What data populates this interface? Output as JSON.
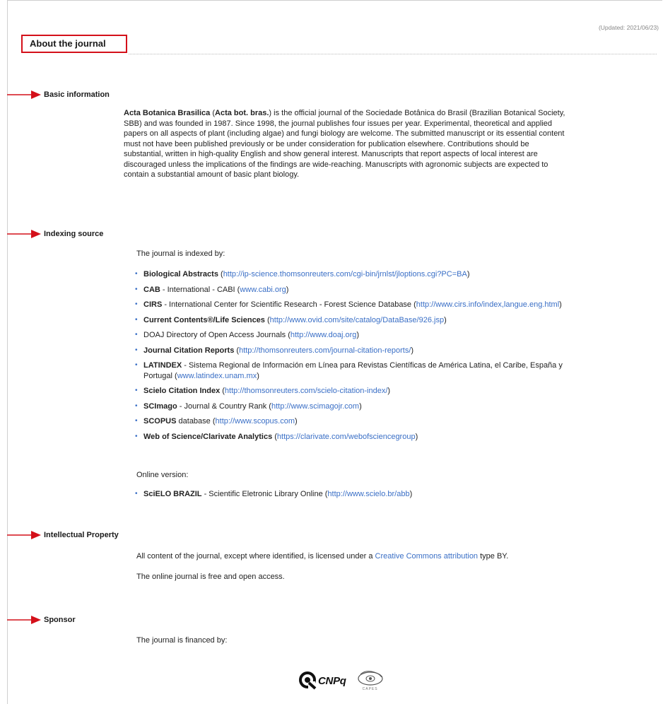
{
  "updated": "(Updated: 2021/06/23)",
  "title": "About the journal",
  "sections": {
    "basic": {
      "label": "Basic information",
      "name_bold": "Acta Botanica Brasilica",
      "abbr_open": " (",
      "abbr_bold": "Acta bot. bras.",
      "body": ") is the official journal of the Sociedade Botânica do Brasil (Brazilian Botanical Society, SBB) and was founded in 1987. Since 1998, the journal publishes four issues per year. Experimental, theoretical and applied papers on all aspects of plant (including algae) and fungi biology are welcome. The submitted manuscript or its essential content must not have been published previously or be under consideration for publication elsewhere. Contributions should be substantial, written in high-quality English and show general interest. Manuscripts that report aspects of local interest are discouraged unless the implications of the findings are wide-reaching. Manuscripts with agronomic subjects are expected to contain a substantial amount of basic plant biology."
    },
    "indexing": {
      "label": "Indexing source",
      "intro": "The journal is indexed by:",
      "items": [
        {
          "bold": "Biological Abstracts",
          "rest": " (",
          "link": "http://ip-science.thomsonreuters.com/cgi-bin/jrnlst/jloptions.cgi?PC=BA",
          "close": ")"
        },
        {
          "bold": "CAB",
          "rest": " - International - CABI (",
          "link": "www.cabi.org",
          "close": ")"
        },
        {
          "bold": "CIRS",
          "rest": " - International Center for Scientific Research - Forest Science Database (",
          "link": "http://www.cirs.info/index,langue.eng.html",
          "close": ")"
        },
        {
          "bold": "Current Contents®/Life Sciences",
          "rest": " (",
          "link": "http://www.ovid.com/site/catalog/DataBase/926.jsp",
          "close": ")"
        },
        {
          "bold": "DOAJ",
          "rest": " Directory of Open Access Journals (",
          "link": "http://www.doaj.org",
          "close": ")"
        },
        {
          "bold": "Journal Citation Reports",
          "rest": " (",
          "link": "http://thomsonreuters.com/journal-citation-reports/",
          "close": ")"
        },
        {
          "bold": "LATINDEX",
          "rest": " - Sistema Regional de Información em Línea para Revistas Científicas de América Latina, el Caribe, España y Portugal (",
          "link": "www.latindex.unam.mx",
          "close": ")"
        },
        {
          "bold": "Scielo Citation Index",
          "rest": " (",
          "link": "http://thomsonreuters.com/scielo-citation-index/",
          "close": ")"
        },
        {
          "bold": "SCImago",
          "rest": " - Journal & Country Rank (",
          "link": "http://www.scimagojr.com",
          "close": ")"
        },
        {
          "bold": "SCOPUS",
          "rest": " database (",
          "link": "http://www.scopus.com",
          "close": ")"
        },
        {
          "bold": "Web of Science/Clarivate Analytics",
          "rest": " (",
          "link": "https://clarivate.com/webofsciencegroup",
          "close": ")"
        }
      ],
      "online_label": "Online version:",
      "online_items": [
        {
          "bold": "SciELO BRAZIL",
          "rest": " - Scientific Eletronic Library Online (",
          "link": "http://www.scielo.br/abb",
          "close": ")"
        }
      ]
    },
    "ip": {
      "label": "Intellectual Property",
      "line1_pre": "All content of the journal, except where identified, is licensed under a ",
      "line1_link": "Creative Commons attribution",
      "line1_post": " type BY.",
      "line2": "The online journal is free and open access."
    },
    "sponsor": {
      "label": "Sponsor",
      "intro": "The journal is financed by:",
      "cnpq_word": "CNPq",
      "capes_word": "CAPES"
    }
  },
  "colors": {
    "accent_red": "#d4101a",
    "link_blue": "#3a6fc6"
  }
}
